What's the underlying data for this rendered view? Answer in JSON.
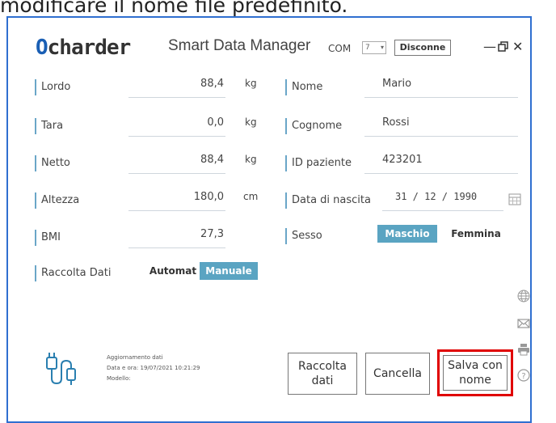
{
  "caption": "modificare il nome file predefinito.",
  "header": {
    "logo_first": "O",
    "logo_rest": "charder",
    "app_title": "Smart Data Manager",
    "com_label": "COM",
    "com_value": "7",
    "disconnect_label": "Disconne",
    "minimize": "—",
    "restore": "▫",
    "close": "✕"
  },
  "left_fields": [
    {
      "label": "Lordo",
      "value": "88,4",
      "unit": "kg"
    },
    {
      "label": "Tara",
      "value": "0,0",
      "unit": "kg"
    },
    {
      "label": "Netto",
      "value": "88,4",
      "unit": "kg"
    },
    {
      "label": "Altezza",
      "value": "180,0",
      "unit": "cm"
    },
    {
      "label": "BMI",
      "value": "27,3",
      "unit": ""
    }
  ],
  "right_fields": [
    {
      "label": "Nome",
      "value": "Mario"
    },
    {
      "label": "Cognome",
      "value": "Rossi"
    },
    {
      "label": "ID paziente",
      "value": "423201"
    },
    {
      "label": "Data di nascita",
      "value": "31 / 12 / 1990"
    }
  ],
  "sesso": {
    "label": "Sesso",
    "options": [
      "Maschio",
      "Femmina"
    ],
    "selected": "Maschio"
  },
  "raccolta": {
    "label": "Raccolta Dati",
    "options": [
      "Automat",
      "Manuale"
    ],
    "selected": "Manuale"
  },
  "info": {
    "line1": "Aggiornamento dati",
    "line2": "Data e ora: 19/07/2021 10:21:29",
    "line3": "Modello:"
  },
  "buttons": {
    "raccolta": "Raccolta dati",
    "cancella": "Cancella",
    "salva": "Salva con nome"
  },
  "colors": {
    "accent": "#5aa4c2",
    "highlight_border": "#e00000",
    "window_border": "#2f6fd0"
  }
}
